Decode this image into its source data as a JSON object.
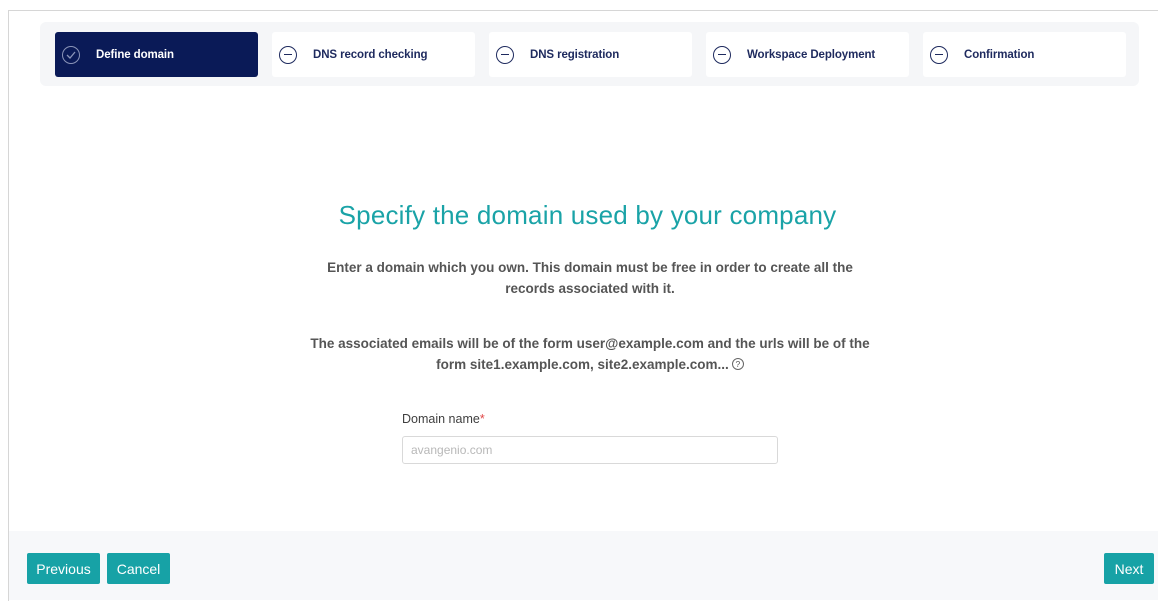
{
  "wizard": {
    "steps": [
      {
        "label": "Define domain",
        "state": "active",
        "icon": "check-circle-icon"
      },
      {
        "label": "DNS record checking",
        "state": "pending",
        "icon": "minus-circle-icon"
      },
      {
        "label": "DNS registration",
        "state": "pending",
        "icon": "minus-circle-icon"
      },
      {
        "label": "Workspace Deployment",
        "state": "pending",
        "icon": "minus-circle-icon"
      },
      {
        "label": "Confirmation",
        "state": "pending",
        "icon": "minus-circle-icon"
      }
    ]
  },
  "main": {
    "title": "Specify the domain used by your company",
    "description1": "Enter a domain which you own. This domain must be free in order to create all the records associated with it.",
    "description2": "The associated emails will be of the form user@example.com and the urls will be of the form site1.example.com, site2.example.com...",
    "help_glyph": "?",
    "domain_field": {
      "label": "Domain name",
      "required_mark": "*",
      "value": "",
      "placeholder": "avangenio.com"
    }
  },
  "footer": {
    "previous_label": "Previous",
    "cancel_label": "Cancel",
    "next_label": "Next"
  },
  "colors": {
    "accent": "#17a2a6",
    "active_step": "#0a1a57",
    "title": "#1aa3a7",
    "required": "#e04646"
  }
}
